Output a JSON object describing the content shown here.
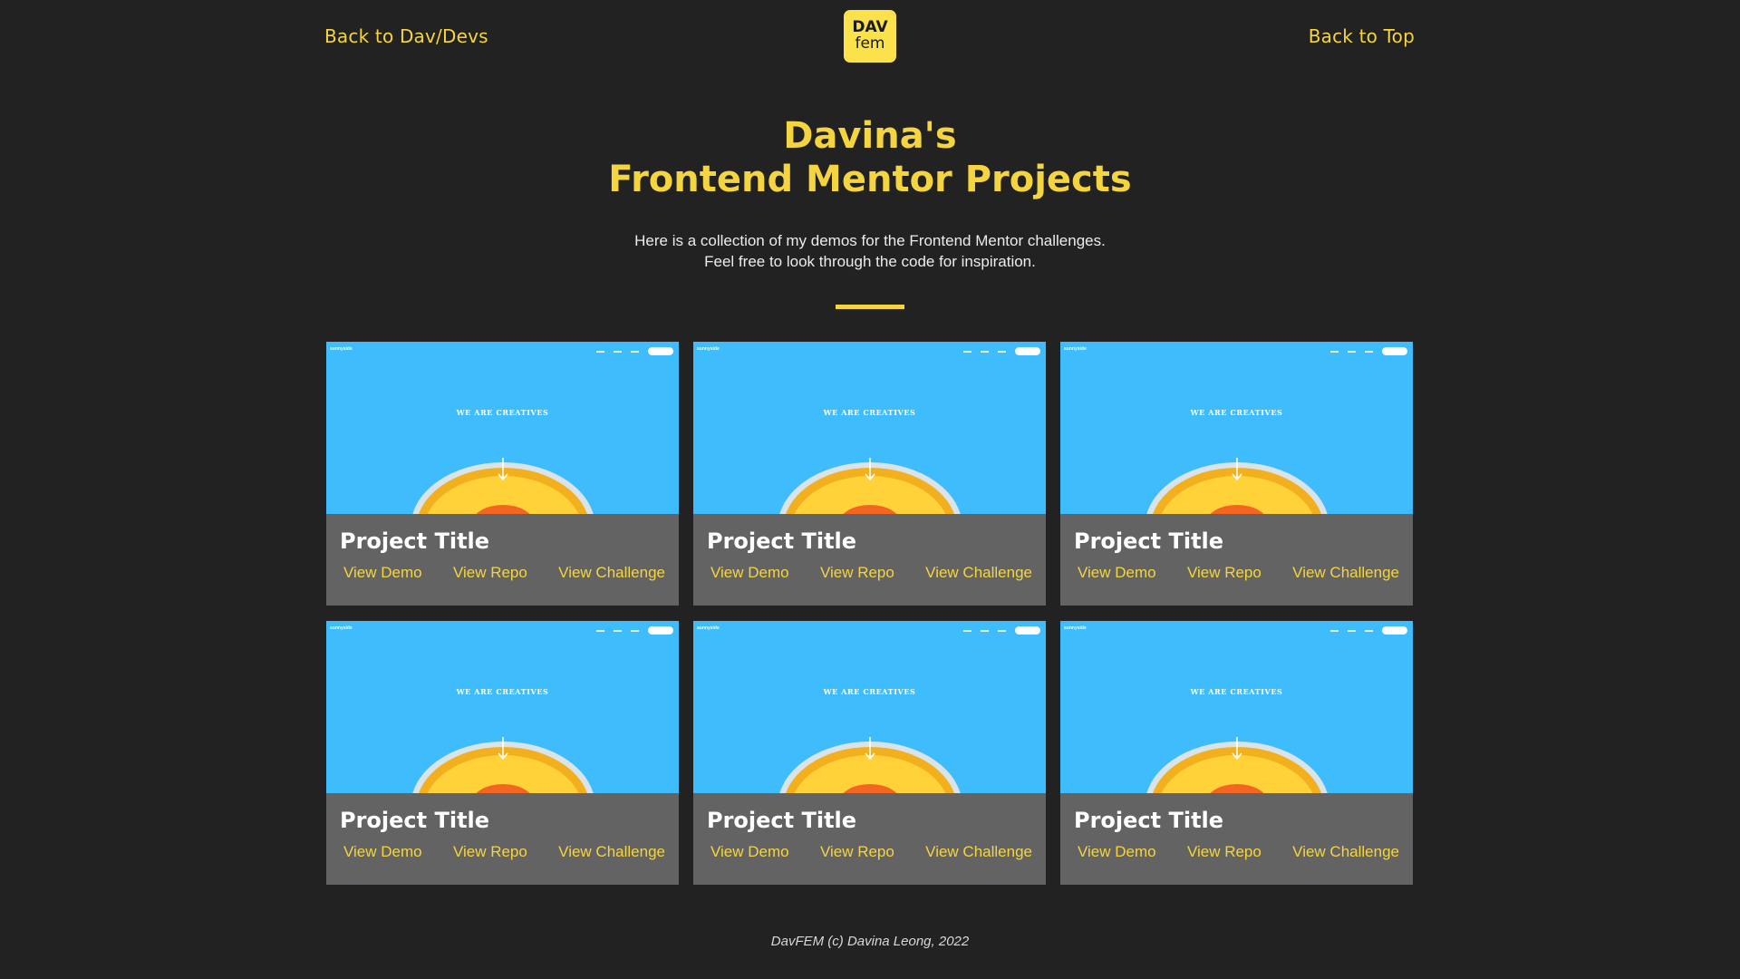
{
  "header": {
    "back_link": "Back to Dav/Devs",
    "top_link": "Back to Top",
    "logo_top": "DAV",
    "logo_bottom": "fem"
  },
  "hero": {
    "title_line1": "Davina's",
    "title_line2": "Frontend Mentor Projects",
    "sub_line1": "Here is a collection of my demos for the Frontend Mentor challenges.",
    "sub_line2": "Feel free to look through the code for inspiration."
  },
  "thumbnail": {
    "brand": "sunnyside",
    "headline": "WE ARE CREATIVES"
  },
  "projects": [
    {
      "title": "Project Title",
      "demo": "View Demo",
      "repo": "View Repo",
      "challenge": "View Challenge"
    },
    {
      "title": "Project Title",
      "demo": "View Demo",
      "repo": "View Repo",
      "challenge": "View Challenge"
    },
    {
      "title": "Project Title",
      "demo": "View Demo",
      "repo": "View Repo",
      "challenge": "View Challenge"
    },
    {
      "title": "Project Title",
      "demo": "View Demo",
      "repo": "View Repo",
      "challenge": "View Challenge"
    },
    {
      "title": "Project Title",
      "demo": "View Demo",
      "repo": "View Repo",
      "challenge": "View Challenge"
    },
    {
      "title": "Project Title",
      "demo": "View Demo",
      "repo": "View Repo",
      "challenge": "View Challenge"
    }
  ],
  "footer": {
    "text": "DavFEM (c) Davina Leong, 2022"
  },
  "colors": {
    "background": "#222222",
    "accent": "#f5d53f",
    "card": "#636363",
    "thumbnail_sky": "#3fbcfb"
  }
}
